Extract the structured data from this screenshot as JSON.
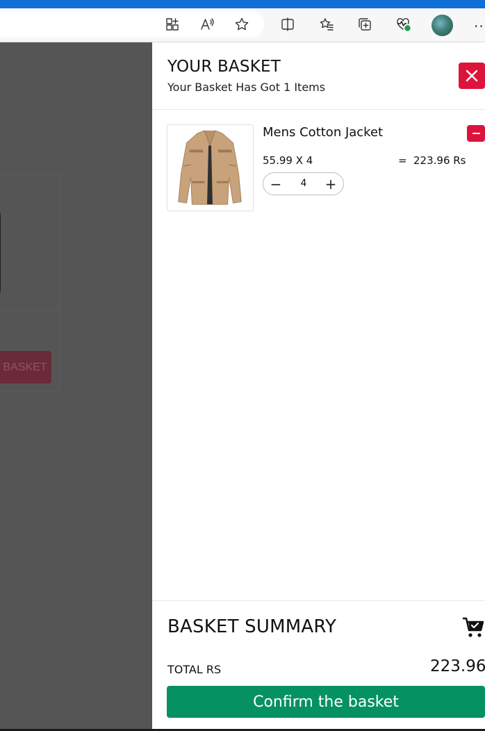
{
  "browser": {
    "icons": [
      "apps-add-icon",
      "read-aloud-icon",
      "favorite-star-icon",
      "split-screen-icon",
      "favorites-icon",
      "collections-icon",
      "browser-essentials-icon",
      "profile-avatar",
      "more-options-icon"
    ],
    "more_options_glyph": "···"
  },
  "background_page": {
    "button_label": "BASKET"
  },
  "basket": {
    "title": "YOUR BASKET",
    "subtitle": "Your Basket Has Got 1 Items",
    "accent_color": "#dc143c",
    "items": [
      {
        "name": "Mens Cotton Jacket",
        "price_line": "55.99 X 4",
        "equals": "=",
        "line_total": "223.96 Rs",
        "quantity": "4",
        "minus_glyph": "−",
        "plus_glyph": "+"
      }
    ]
  },
  "summary": {
    "title": "BASKET SUMMARY",
    "total_label": "TOTAL RS",
    "total_value": "223.96",
    "confirm_label": "Confirm the basket",
    "confirm_color": "#069163"
  }
}
